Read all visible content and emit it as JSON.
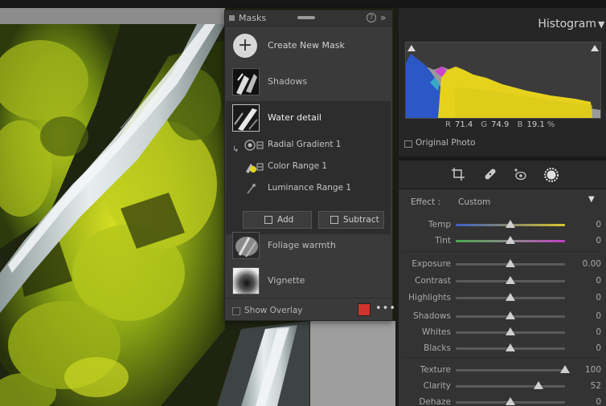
{
  "masks_panel": {
    "title": "Masks",
    "create_label": "Create New Mask",
    "items": [
      {
        "label": "Shadows"
      },
      {
        "label": "Water detail",
        "selected": true
      },
      {
        "label": "Foliage warmth"
      },
      {
        "label": "Vignette"
      }
    ],
    "components": [
      {
        "label": "Radial Gradient 1",
        "icon": "radial-gradient-icon"
      },
      {
        "label": "Color Range 1",
        "icon": "color-range-icon"
      },
      {
        "label": "Luminance Range 1",
        "icon": "luminance-range-icon"
      }
    ],
    "add_label": "Add",
    "subtract_label": "Subtract",
    "show_overlay_label": "Show Overlay",
    "overlay_color": "#d0342c"
  },
  "histogram": {
    "title": "Histogram",
    "r_label": "R",
    "r_value": "71.4",
    "g_label": "G",
    "g_value": "74.9",
    "b_label": "B",
    "b_value": "19.1",
    "unit": "%",
    "original_photo_label": "Original Photo"
  },
  "tools": [
    "crop-icon",
    "healing-icon",
    "red-eye-icon",
    "masking-icon"
  ],
  "effect": {
    "label": "Effect :",
    "value": "Custom"
  },
  "sliders": [
    {
      "label": "Temp",
      "value": "0",
      "pos": 0.5
    },
    {
      "label": "Tint",
      "value": "0",
      "pos": 0.5
    },
    {
      "label": "Exposure",
      "value": "0.00",
      "pos": 0.5
    },
    {
      "label": "Contrast",
      "value": "0",
      "pos": 0.5
    },
    {
      "label": "Highlights",
      "value": "0",
      "pos": 0.5
    },
    {
      "label": "Shadows",
      "value": "0",
      "pos": 0.5
    },
    {
      "label": "Whites",
      "value": "0",
      "pos": 0.5
    },
    {
      "label": "Blacks",
      "value": "0",
      "pos": 0.5
    },
    {
      "label": "Texture",
      "value": "100",
      "pos": 1.0
    },
    {
      "label": "Clarity",
      "value": "52",
      "pos": 0.76
    },
    {
      "label": "Dehaze",
      "value": "0",
      "pos": 0.5
    }
  ],
  "colors": {
    "panel": "#3a3a3a",
    "accent_overlay": "#d0342c",
    "histogram_yellow": "#e6d21c",
    "histogram_blue": "#2c57c7"
  }
}
